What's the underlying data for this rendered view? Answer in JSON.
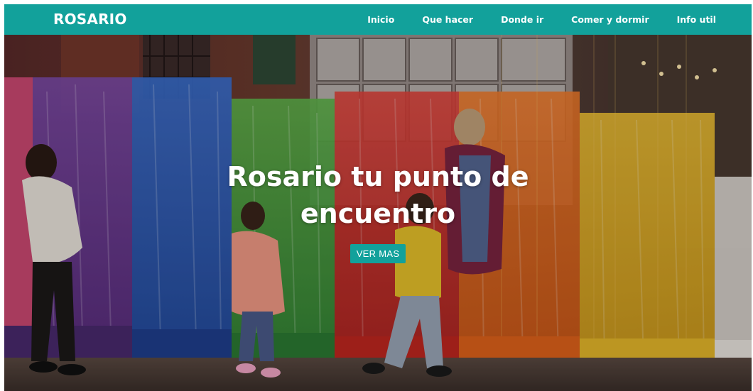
{
  "navbar": {
    "brand": "ROSARIO",
    "items": [
      {
        "label": "Inicio"
      },
      {
        "label": "Que hacer"
      },
      {
        "label": "Donde ir"
      },
      {
        "label": "Comer y dormir"
      },
      {
        "label": "Info util"
      }
    ]
  },
  "hero": {
    "title": "Rosario tu punto de encuentro",
    "button_label": "VER MAS",
    "image_icon": "hero-photo-rainbow-ribbons"
  },
  "colors": {
    "accent": "#12a19b",
    "text_on_accent": "#ffffff"
  }
}
